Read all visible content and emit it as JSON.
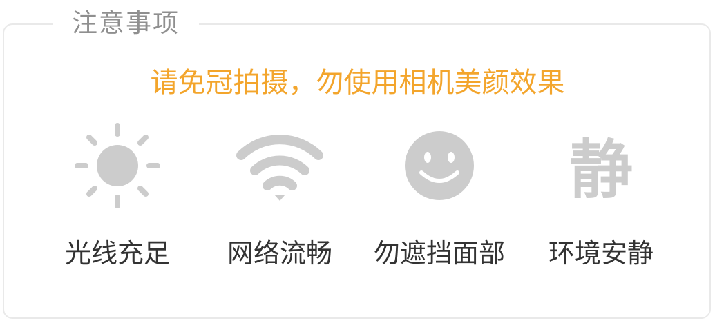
{
  "section": {
    "title": "注意事项"
  },
  "notice": {
    "text": "请免冠拍摄，勿使用相机美颜效果",
    "color": "#f3a52c"
  },
  "icon_color": "#cccccc",
  "tips": [
    {
      "icon": "sun-icon",
      "label": "光线充足"
    },
    {
      "icon": "wifi-icon",
      "label": "网络流畅"
    },
    {
      "icon": "smiley-face-icon",
      "label": "勿遮挡面部"
    },
    {
      "icon": "quiet-character-icon",
      "glyph": "静",
      "label": "环境安静"
    }
  ]
}
